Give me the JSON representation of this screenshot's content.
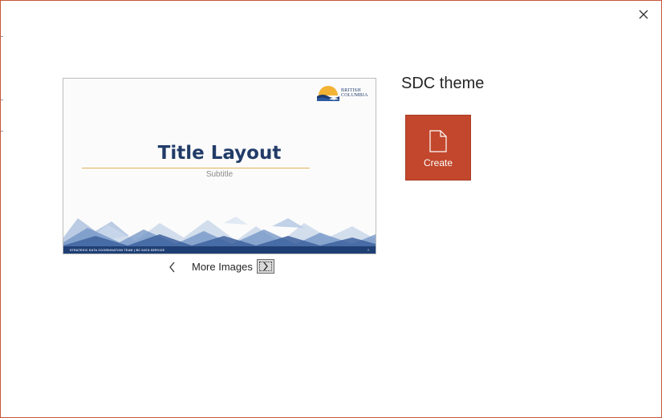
{
  "dialog": {
    "close_icon": "close-icon"
  },
  "preview": {
    "logo_text_line1": "BRITISH",
    "logo_text_line2": "COLUMBIA",
    "slide_title": "Title Layout",
    "slide_subtitle": "Subtitle",
    "footer_text": "STRATEGIC DATA COORDINATION TEAM | BC DATA SERVICE",
    "page_number": "2",
    "colors": {
      "title": "#223c68",
      "rule": "#e0b35c",
      "footer": "#1f3f74"
    }
  },
  "gallery": {
    "prev_icon": "chevron-left-icon",
    "label": "More Images",
    "next_icon": "chevron-right-icon"
  },
  "theme": {
    "name": "SDC theme",
    "create_label": "Create",
    "create_icon": "document-icon",
    "accent": "#c2472c"
  }
}
